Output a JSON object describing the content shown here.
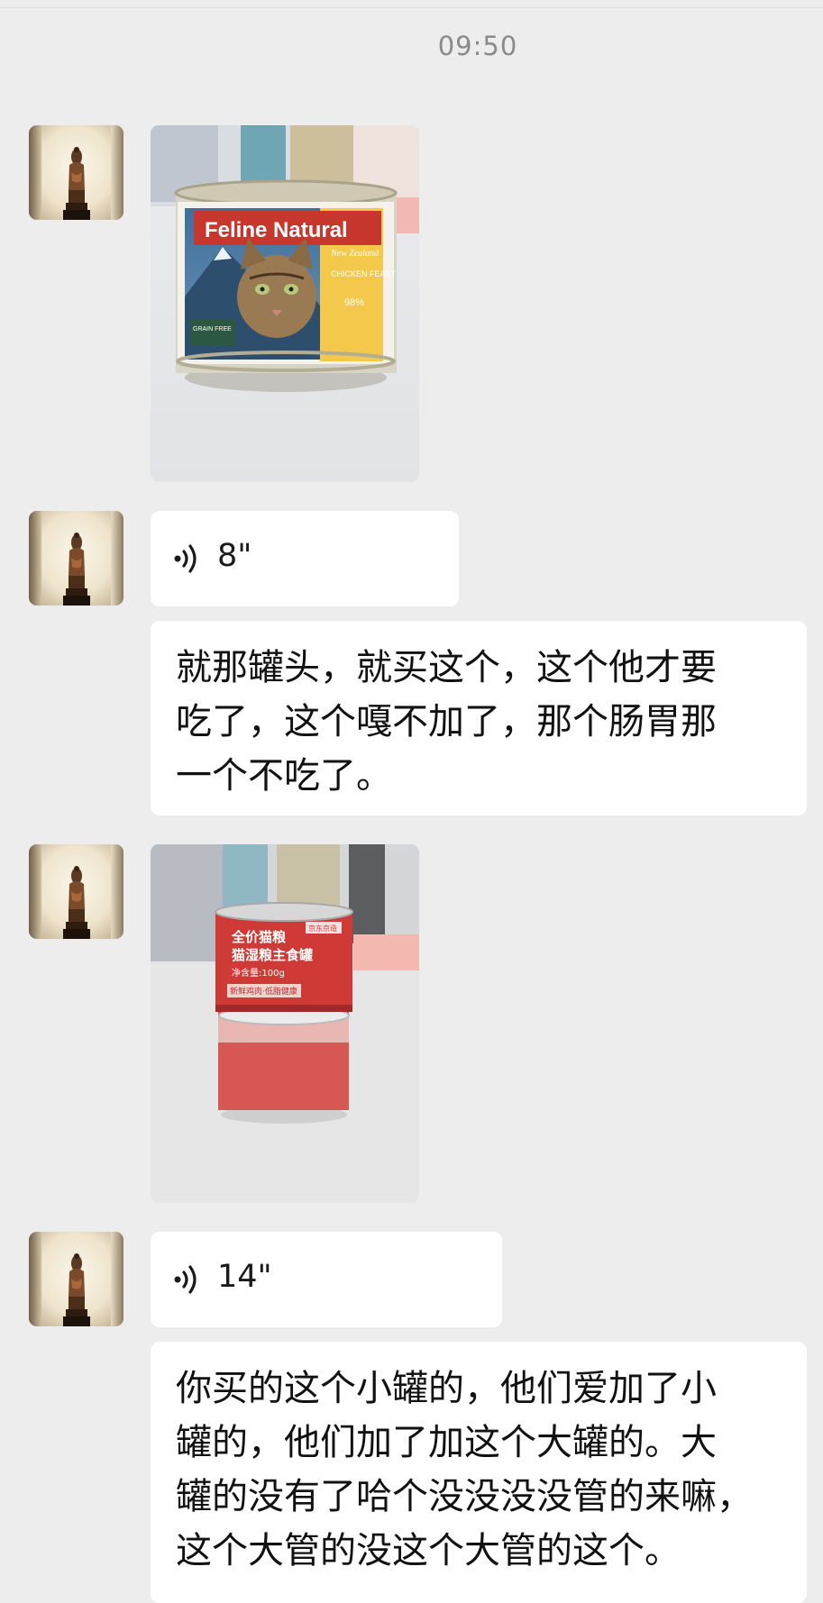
{
  "timestamp": "09:50",
  "messages": [
    {
      "type": "image",
      "brand_text": "Feline Natural",
      "sub_text": "New Zealand",
      "flavor_text": "CHICKEN FEAST",
      "percent_text": "98%",
      "badge_text": "GRAIN FREE"
    },
    {
      "type": "voice",
      "duration": "8\""
    },
    {
      "type": "text",
      "lines": [
        "就那罐头，就买这个，这个他才要",
        "吃了，这个嘎不加了，那个肠胃那",
        "一个不吃了。"
      ]
    },
    {
      "type": "image",
      "label_line1": "全价猫粮",
      "label_line2": "猫湿粮主食罐",
      "weight_text": "净含量:100g",
      "bottom_text": "新鲜鸡肉·低脂健康",
      "corner_tag": "京东京造"
    },
    {
      "type": "voice",
      "duration": "14\""
    },
    {
      "type": "text",
      "lines": [
        "你买的这个小罐的，他们爱加了小",
        "罐的，他们加了加这个大罐的。大",
        "罐的没有了哈个没没没没管的来嘛，",
        "这个大管的没这个大管的这个。"
      ]
    }
  ],
  "colors": {
    "background": "#ededed",
    "bubble": "#ffffff",
    "timestamp": "#8a8a8a",
    "feline_red": "#c8372d",
    "can_red": "#cf3a36"
  },
  "icons": {
    "voice": "voice-wave-icon",
    "avatar": "statue-avatar"
  }
}
